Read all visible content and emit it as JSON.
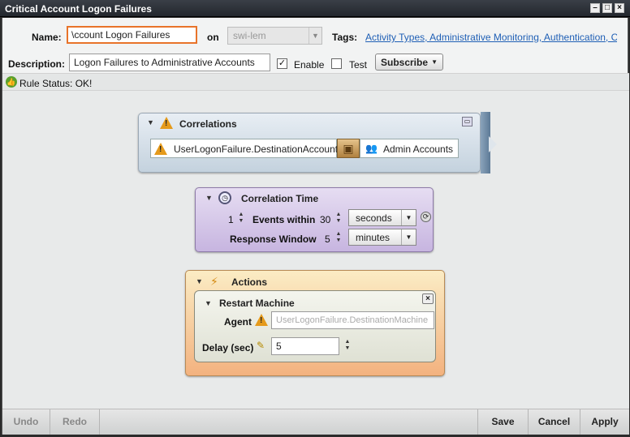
{
  "window": {
    "title": "Critical Account Logon Failures"
  },
  "form": {
    "name_label": "Name:",
    "name_value": "\\ccount Logon Failures",
    "on_label": "on",
    "on_value": "swi-lem",
    "tags_label": "Tags:",
    "tags_value": "Activity Types, Administrative Monitoring, Authentication, Co...",
    "description_label": "Description:",
    "description_value": "Logon Failures to Administrative Accounts",
    "enable_label": "Enable",
    "enable_checked": true,
    "test_label": "Test",
    "test_checked": false,
    "subscribe_label": "Subscribe"
  },
  "status": {
    "text": "Rule Status: OK!"
  },
  "correlations": {
    "title": "Correlations",
    "field": "UserLogonFailure.DestinationAccount",
    "target": "Admin Accounts"
  },
  "correlation_time": {
    "title": "Correlation Time",
    "events_count": "1",
    "events_within_label": "Events within",
    "within_value": "30",
    "within_unit": "seconds",
    "response_window_label": "Response Window",
    "response_value": "5",
    "response_unit": "minutes"
  },
  "actions": {
    "title": "Actions",
    "action_title": "Restart Machine",
    "agent_label": "Agent",
    "agent_placeholder": "UserLogonFailure.DestinationMachine",
    "delay_label": "Delay (sec)",
    "delay_value": "5"
  },
  "bottom": {
    "undo": "Undo",
    "redo": "Redo",
    "save": "Save",
    "cancel": "Cancel",
    "apply": "Apply"
  }
}
